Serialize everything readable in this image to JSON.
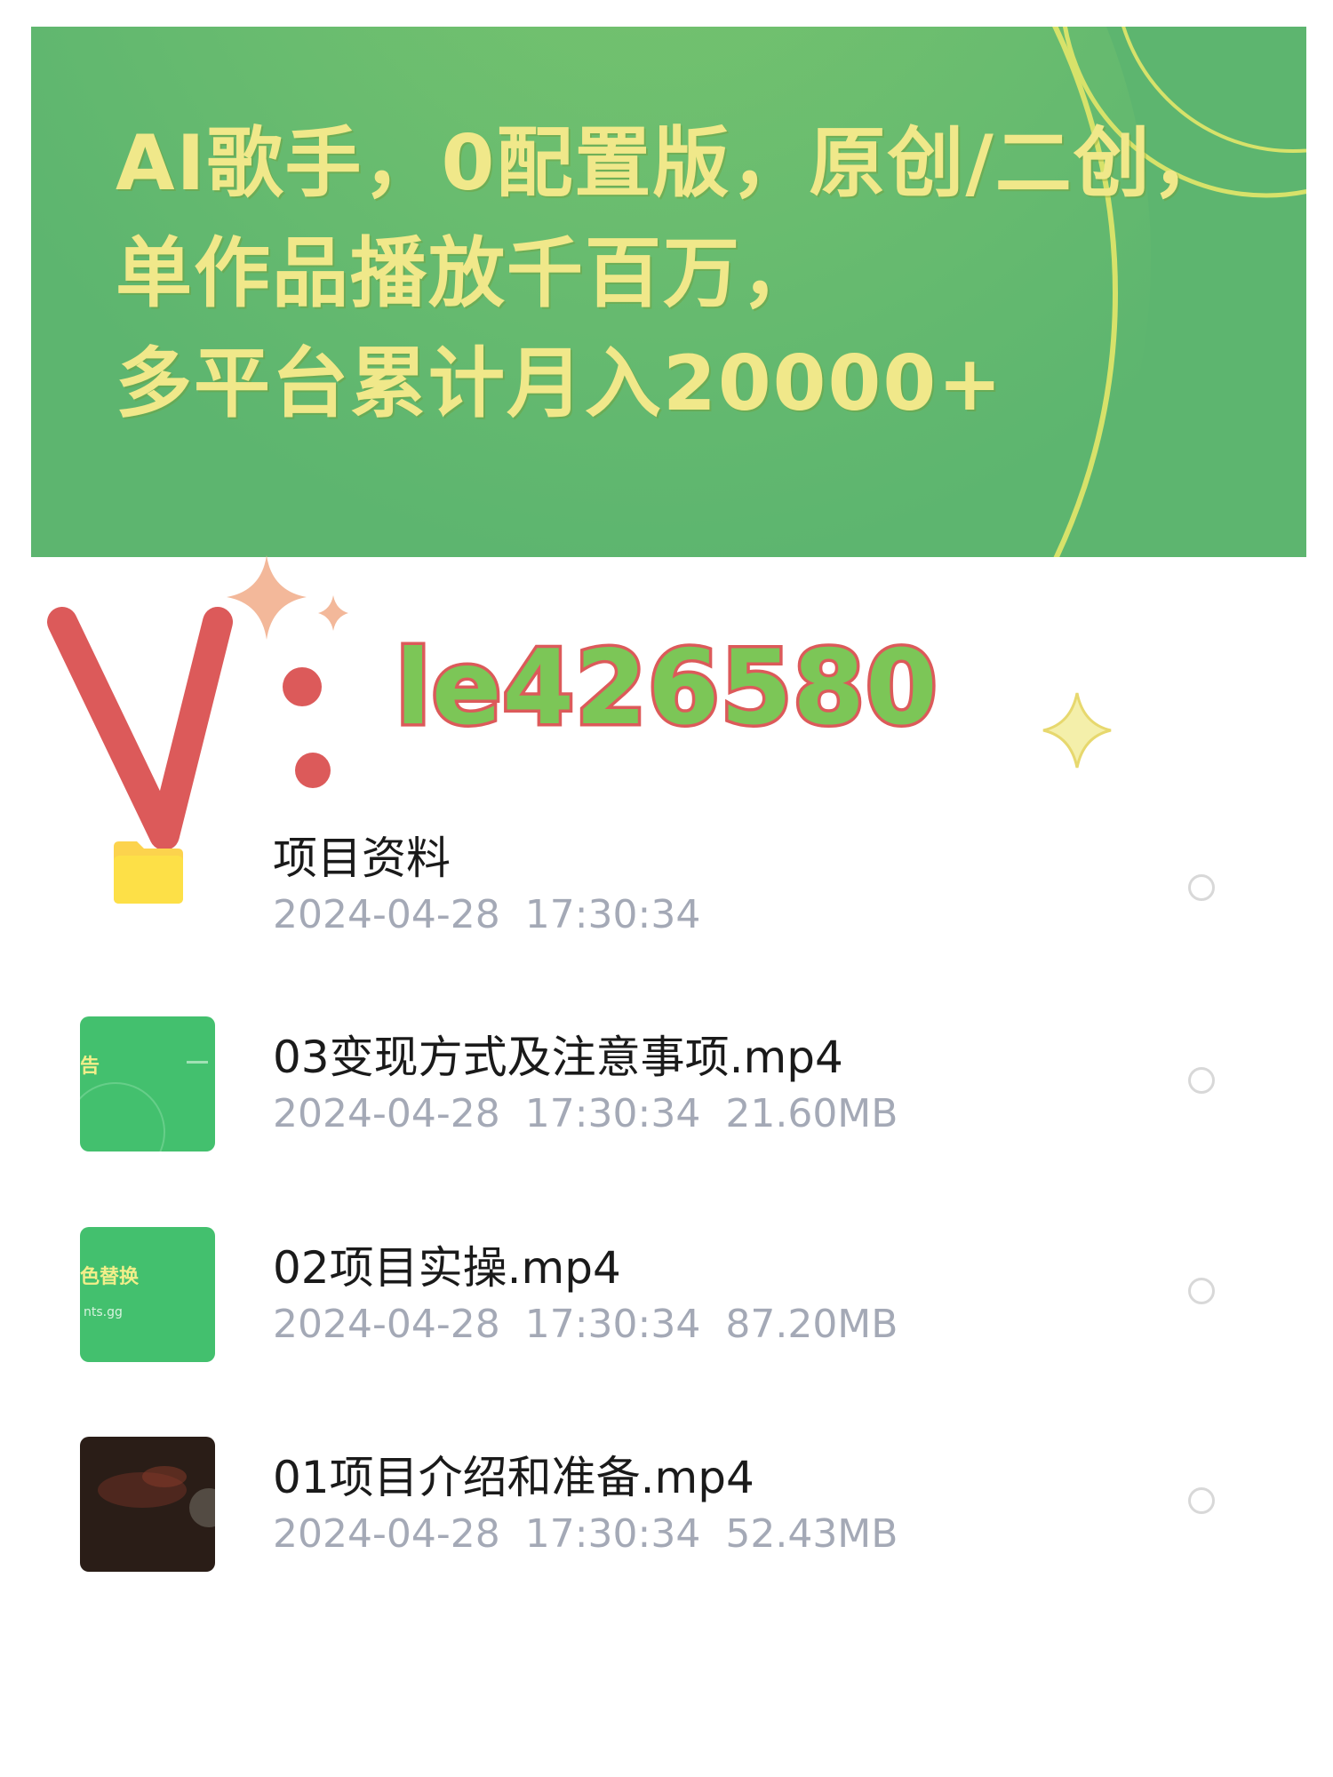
{
  "banner": {
    "lines": [
      "AI歌手，0配置版，原创/二创，",
      "单作品播放千百万，",
      "多平台累计月入20000+"
    ]
  },
  "contact": {
    "letter": "V",
    "id": "le426580"
  },
  "files": [
    {
      "name": "项目资料",
      "date": "2024-04-28",
      "time": "17:30:34",
      "size": "",
      "icon": "folder-icon"
    },
    {
      "name": "03变现方式及注意事项.mp4",
      "date": "2024-04-28",
      "time": "17:30:34",
      "size": "21.60MB",
      "icon": "video-thumbnail",
      "thumb_text": "告"
    },
    {
      "name": "02项目实操.mp4",
      "date": "2024-04-28",
      "time": "17:30:34",
      "size": "87.20MB",
      "icon": "video-thumbnail",
      "thumb_text": "色替换",
      "thumb_sub": "nts.gg"
    },
    {
      "name": "01项目介绍和准备.mp4",
      "date": "2024-04-28",
      "time": "17:30:34",
      "size": "52.43MB",
      "icon": "video-thumbnail"
    }
  ],
  "colors": {
    "banner_bg": "#5db56f",
    "banner_text": "#f0e88a",
    "contact_fill": "#7cc657",
    "contact_stroke": "#dc5a5a",
    "meta_text": "#a4a9b6",
    "folder": "#fcd34d"
  }
}
